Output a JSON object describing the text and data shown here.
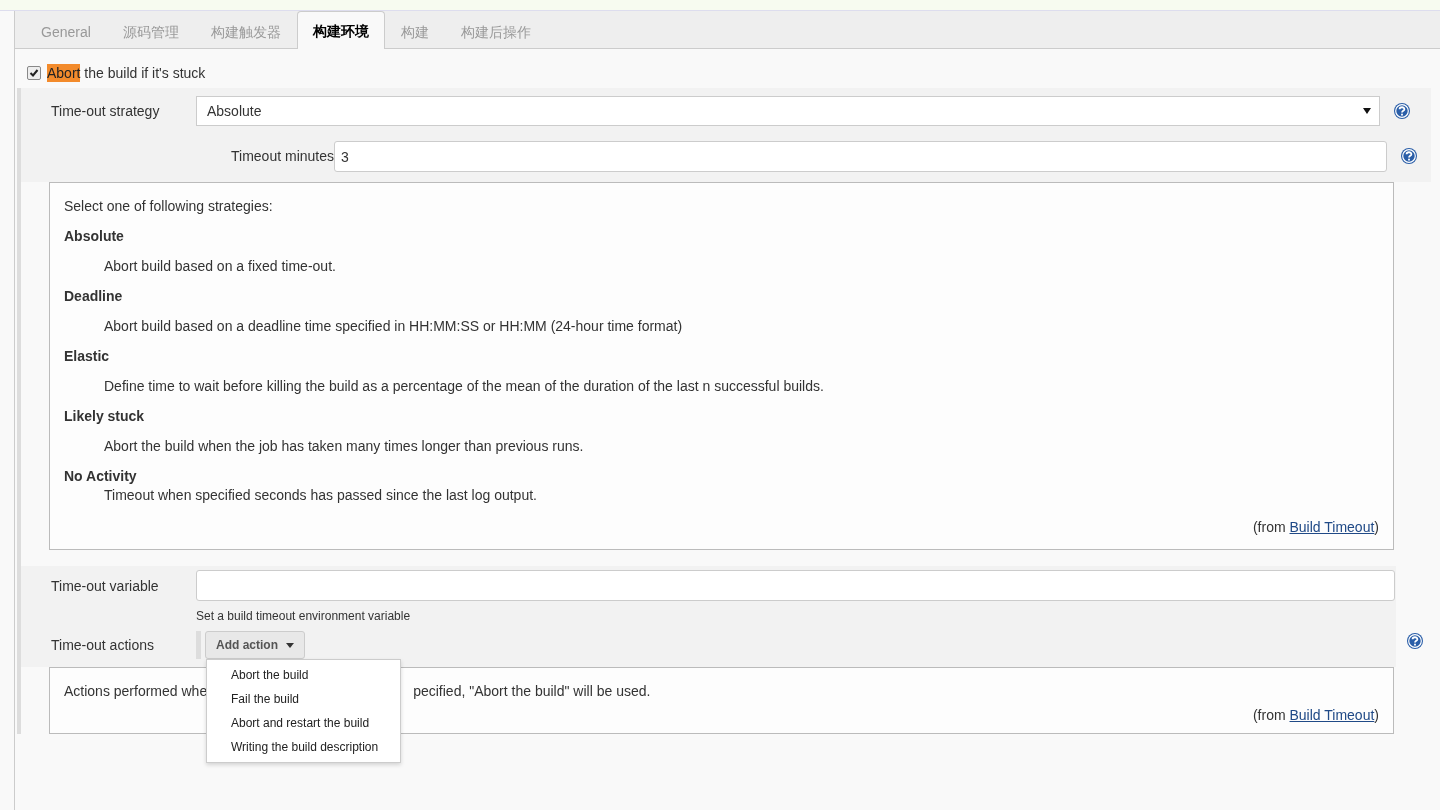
{
  "tabs": [
    {
      "label": "General",
      "selected": false
    },
    {
      "label": "源码管理",
      "selected": false
    },
    {
      "label": "构建触发器",
      "selected": false
    },
    {
      "label": "构建环境",
      "selected": true
    },
    {
      "label": "构建",
      "selected": false
    },
    {
      "label": "构建后操作",
      "selected": false
    }
  ],
  "abort_option": {
    "highlight": "Abort",
    "label": " the build if it's stuck",
    "checked": true
  },
  "strategy": {
    "label": "Time-out strategy",
    "value": "Absolute"
  },
  "timeout_minutes": {
    "label": "Timeout minutes",
    "value": "3"
  },
  "strategy_help": {
    "intro": "Select one of following strategies:",
    "items": [
      {
        "term": "Absolute",
        "description": "Abort build based on a fixed time-out."
      },
      {
        "term": "Deadline",
        "description": "Abort build based on a deadline time specified in HH:MM:SS or HH:MM (24-hour time format)"
      },
      {
        "term": "Elastic",
        "description": "Define time to wait before killing the build as a percentage of the mean of the duration of the last n successful builds."
      },
      {
        "term": "Likely stuck",
        "description": "Abort the build when the job has taken many times longer than previous runs."
      },
      {
        "term": "No Activity",
        "description": "Timeout when specified seconds has passed since the last log output."
      }
    ],
    "from_prefix": "(from ",
    "from_link": "Build Timeout",
    "from_suffix": ")"
  },
  "timeout_variable": {
    "label": "Time-out variable",
    "hint": "Set a build timeout environment variable"
  },
  "timeout_actions": {
    "label": "Time-out actions",
    "button": "Add action",
    "menu": [
      "Abort the build",
      "Fail the build",
      "Abort and restart the build",
      "Writing the build description"
    ]
  },
  "actions_help": {
    "text_before": "Actions performed whe",
    "text_after": "pecified, \"Abort the build\" will be used.",
    "from_prefix": "(from ",
    "from_link": "Build Timeout",
    "from_suffix": ")"
  }
}
